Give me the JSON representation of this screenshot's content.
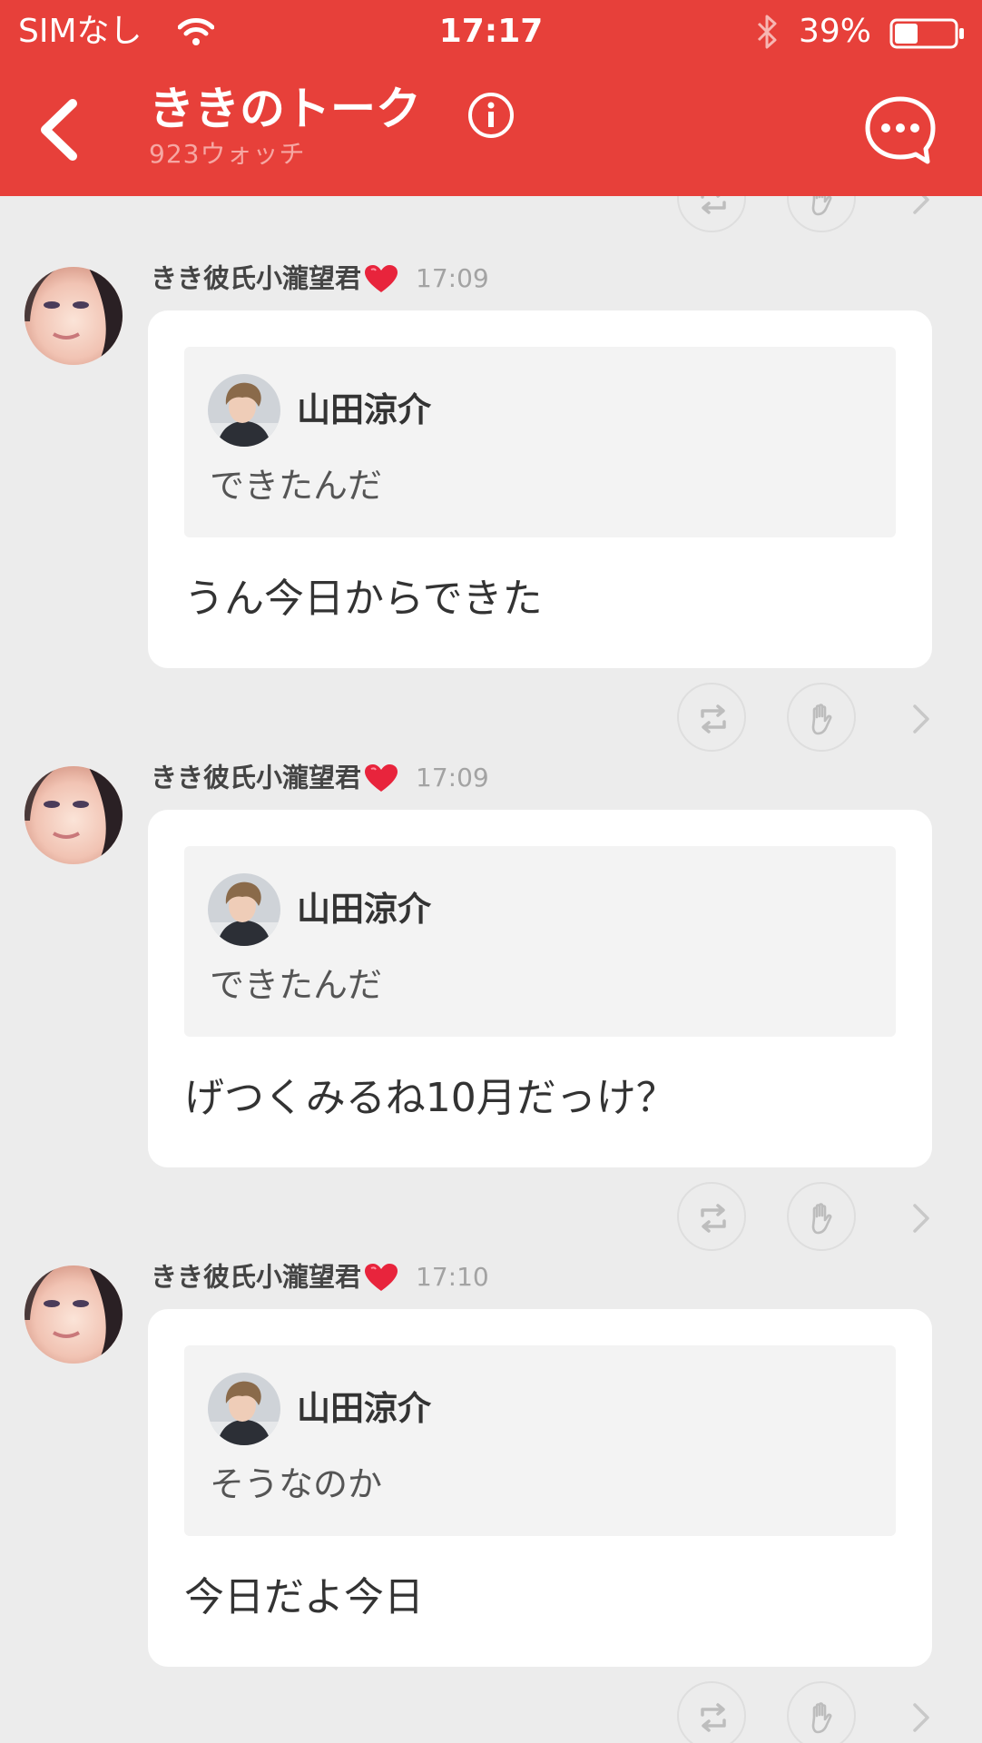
{
  "status_bar": {
    "carrier": "SIMなし",
    "time": "17:17",
    "battery_percent": "39%",
    "battery_level": 0.39,
    "icons": [
      "wifi-icon",
      "bluetooth-icon",
      "battery-icon"
    ]
  },
  "nav": {
    "title": "ききのトーク",
    "subtitle": "923ウォッチ",
    "icons": [
      "back-chevron-icon",
      "info-icon",
      "chat-bubble-icon"
    ]
  },
  "actions": {
    "icons": [
      "repost-icon",
      "clap-icon",
      "chevron-right-icon"
    ]
  },
  "messages": [
    {
      "sender": "きき彼氏小瀧望君",
      "sender_icon": "heart-icon",
      "time": "17:09",
      "quote": {
        "name": "山田涼介",
        "text": "できたんだ"
      },
      "text": "うん今日からできた"
    },
    {
      "sender": "きき彼氏小瀧望君",
      "sender_icon": "heart-icon",
      "time": "17:09",
      "quote": {
        "name": "山田涼介",
        "text": "できたんだ"
      },
      "text": "げつくみるね10月だっけ？"
    },
    {
      "sender": "きき彼氏小瀧望君",
      "sender_icon": "heart-icon",
      "time": "17:10",
      "quote": {
        "name": "山田涼介",
        "text": "そうなのか"
      },
      "text": "今日だよ今日"
    }
  ],
  "colors": {
    "brand_red": "#e7403a",
    "background": "#ececec",
    "bubble": "#ffffff",
    "quote_box": "#f3f3f3"
  }
}
